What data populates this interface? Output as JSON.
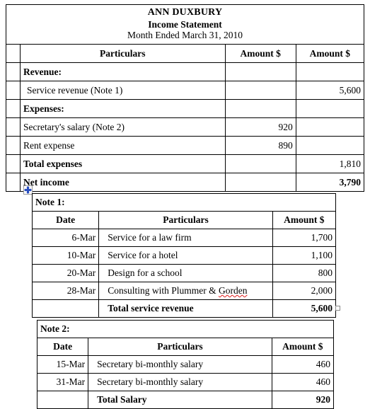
{
  "document": {
    "statement": {
      "title_line_1": "ANN DUXBURY",
      "title_line_2": "Income Statement",
      "title_line_3": "Month Ended March 31, 2010",
      "columns": {
        "particulars": "Particulars",
        "amount_1": "Amount $",
        "amount_2": "Amount $"
      },
      "rows": [
        {
          "particulars": "Revenue:",
          "amount_1": "",
          "amount_2": "",
          "bold": true,
          "indent": 0
        },
        {
          "particulars": "Service revenue (Note 1)",
          "amount_1": "",
          "amount_2": "5,600",
          "bold": false,
          "indent": 1
        },
        {
          "particulars": "Expenses:",
          "amount_1": "",
          "amount_2": "",
          "bold": true,
          "indent": 0
        },
        {
          "particulars": "Secretary's salary (Note 2)",
          "amount_1": "920",
          "amount_2": "",
          "bold": false,
          "indent": 0
        },
        {
          "particulars": "Rent expense",
          "amount_1": "890",
          "amount_2": "",
          "bold": false,
          "indent": 0
        },
        {
          "particulars": "Total expenses",
          "amount_1": "",
          "amount_2": "1,810",
          "bold": true,
          "indent": 0
        },
        {
          "particulars": "Net income",
          "amount_1": "",
          "amount_2": "3,790",
          "bold": true,
          "indent": 0
        }
      ]
    },
    "note_1": {
      "label": "Note 1:",
      "columns": {
        "date": "Date",
        "particulars": "Particulars",
        "amount": "Amount $"
      },
      "rows": [
        {
          "date": "6-Mar",
          "particulars": "Service for a law firm",
          "amount": "1,700"
        },
        {
          "date": "10-Mar",
          "particulars": "Service for a hotel",
          "amount": "1,100"
        },
        {
          "date": "20-Mar",
          "particulars": "Design for a school",
          "amount": "800"
        },
        {
          "date": "28-Mar",
          "particulars": "Consulting with Plummer & Gorden",
          "amount": "2,000"
        }
      ],
      "total_label": "Total service revenue",
      "total_amount": "5,600",
      "misspelled_word": "Gorden",
      "particulars_prefix": "Consulting with Plummer & "
    },
    "note_2": {
      "label": "Note 2:",
      "columns": {
        "date": "Date",
        "particulars": "Particulars",
        "amount": "Amount $"
      },
      "rows": [
        {
          "date": "15-Mar",
          "particulars": "Secretary bi-monthly salary",
          "amount": "460"
        },
        {
          "date": "31-Mar",
          "particulars": "Secretary bi-monthly salary",
          "amount": "460"
        }
      ],
      "total_label": "Total Salary",
      "total_amount": "920"
    },
    "handles": {
      "move_handle_icon": "move-cross-icon",
      "resize_handle_icon": "resize-square-icon"
    },
    "colors": {
      "grid_line": "#000000",
      "page_background": "#ffffff",
      "text": "#000000",
      "handle_accent": "#2a4fc0",
      "spellcheck_underline": "#e01b1b",
      "handle_border": "#9a9a9a"
    }
  }
}
